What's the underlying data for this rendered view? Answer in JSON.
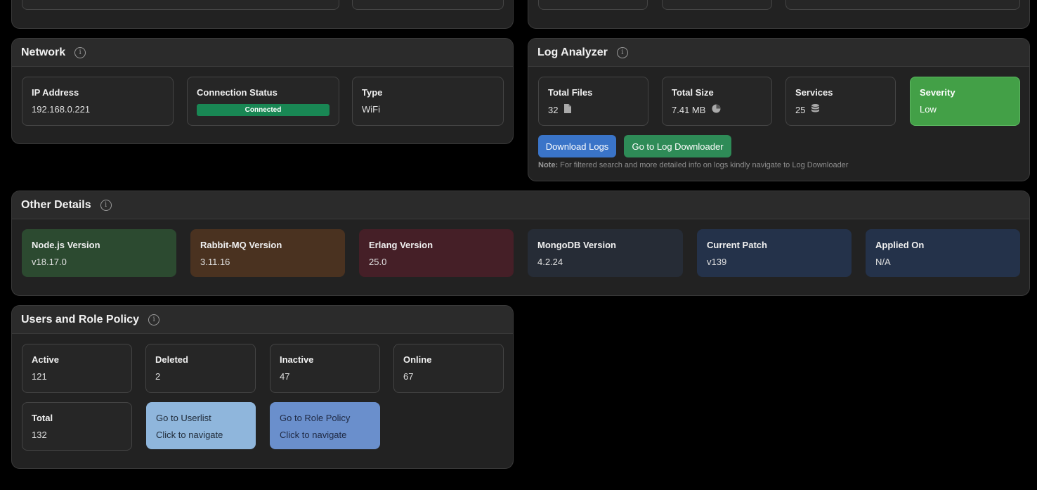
{
  "network": {
    "title": "Network",
    "ip_label": "IP Address",
    "ip_value": "192.168.0.221",
    "conn_label": "Connection Status",
    "conn_value": "Connected",
    "type_label": "Type",
    "type_value": "WiFi"
  },
  "log_analyzer": {
    "title": "Log Analyzer",
    "files_label": "Total Files",
    "files_value": "32",
    "size_label": "Total Size",
    "size_value": "7.41 MB",
    "services_label": "Services",
    "services_value": "25",
    "severity_label": "Severity",
    "severity_value": "Low",
    "download_label": "Download Logs",
    "goto_label": "Go to Log Downloader",
    "note_bold": "Note:",
    "note_text": " For filtered search and more detailed info on logs kindly navigate to Log Downloader"
  },
  "other_details": {
    "title": "Other Details",
    "items": [
      {
        "label": "Node.js Version",
        "value": "v18.17.0",
        "color": "#2c4a30"
      },
      {
        "label": "Rabbit-MQ Version",
        "value": "3.11.16",
        "color": "#4a3220"
      },
      {
        "label": "Erlang Version",
        "value": "25.0",
        "color": "#451f27"
      },
      {
        "label": "MongoDB Version",
        "value": "4.2.24",
        "color": "#262c36"
      },
      {
        "label": "Current Patch",
        "value": "v139",
        "color": "#24324a"
      },
      {
        "label": "Applied On",
        "value": "N/A",
        "color": "#24324a"
      }
    ]
  },
  "users": {
    "title": "Users and Role Policy",
    "active_label": "Active",
    "active_value": "121",
    "deleted_label": "Deleted",
    "deleted_value": "2",
    "inactive_label": "Inactive",
    "inactive_value": "47",
    "online_label": "Online",
    "online_value": "67",
    "total_label": "Total",
    "total_value": "132",
    "userlist_label": "Go to Userlist",
    "userlist_sub": "Click to navigate",
    "role_label": "Go to Role Policy",
    "role_sub": "Click to navigate"
  },
  "colors": {
    "connected": "#198754",
    "severity_low": "#43a047",
    "download_btn": "#3a74c8",
    "goto_btn": "#2e8b57",
    "userlist_card": "#8fb6dc",
    "role_card": "#6a8fcc"
  },
  "icons": {
    "files": "file-icon",
    "size": "pie-chart-icon",
    "services": "database-icon",
    "info": "info-icon"
  }
}
